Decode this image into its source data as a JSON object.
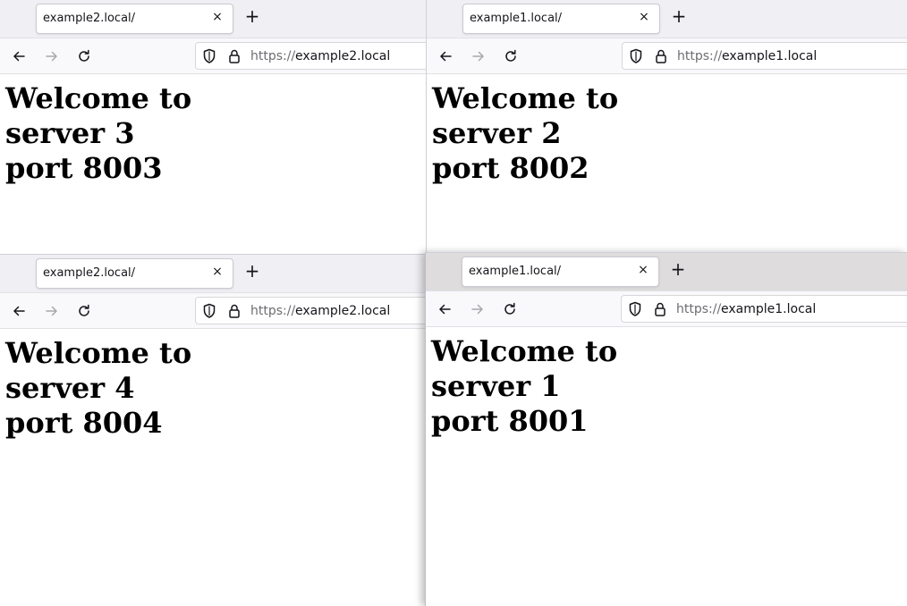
{
  "windows": {
    "top_left": {
      "tab_title": "example2.local/",
      "url_scheme": "https://",
      "url_host": "example2.local",
      "lines": [
        "Welcome to",
        "server 3",
        "port 8003"
      ]
    },
    "top_right": {
      "tab_title": "example1.local/",
      "url_scheme": "https://",
      "url_host": "example1.local",
      "lines": [
        "Welcome to",
        "server 2",
        "port 8002"
      ]
    },
    "bottom_left": {
      "tab_title": "example2.local/",
      "url_scheme": "https://",
      "url_host": "example2.local",
      "lines": [
        "Welcome to",
        "server 4",
        "port 8004"
      ]
    },
    "bottom_right": {
      "tab_title": "example1.local/",
      "url_scheme": "https://",
      "url_host": "example1.local",
      "lines": [
        "Welcome to",
        "server 1",
        "port 8001"
      ]
    }
  },
  "icons": {
    "tab_close": "×",
    "new_tab": "+",
    "back": "back-arrow-icon",
    "forward": "forward-arrow-icon",
    "reload": "reload-icon",
    "shield": "tracking-protection-shield-icon",
    "lock": "padlock-icon"
  },
  "colors": {
    "tabbar_bg": "#f0f0f4",
    "active_window_tabbar_bg": "#dedcdc",
    "navbar_bg": "#f9f9fb",
    "text": "#15141a",
    "url_scheme": "#6d6d72"
  }
}
